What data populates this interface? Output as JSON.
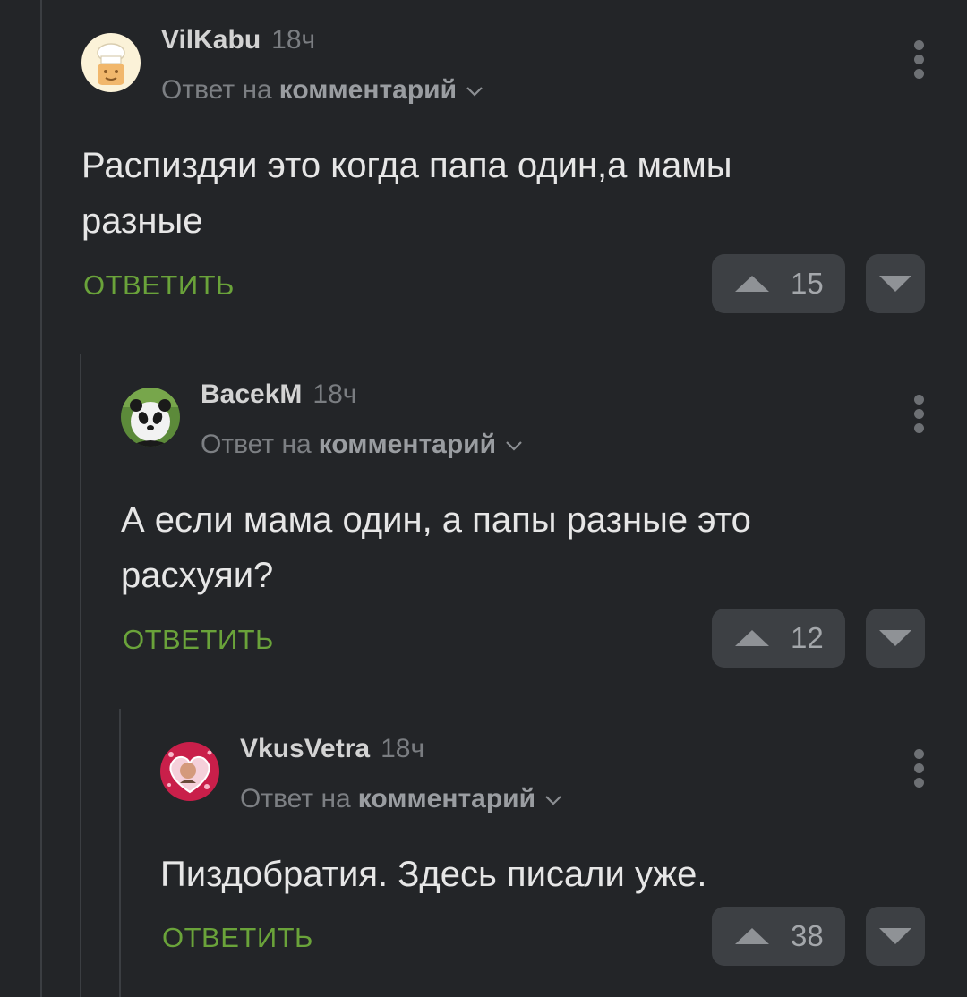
{
  "comments": [
    {
      "username": "VilKabu",
      "time": "18ч",
      "reply_prefix": "Ответ на",
      "reply_target": "комментарий",
      "text": "Распиздяи это когда папа один,а мамы разные",
      "reply_label": "ОТВЕТИТЬ",
      "rating": "15",
      "avatar_icon": "chef-avatar-icon"
    },
    {
      "username": "BacekM",
      "time": "18ч",
      "reply_prefix": "Ответ на",
      "reply_target": "комментарий",
      "text": "А если мама один, а папы разные это расхуяи?",
      "reply_label": "ОТВЕТИТЬ",
      "rating": "12",
      "avatar_icon": "panda-avatar-icon"
    },
    {
      "username": "VkusVetra",
      "time": "18ч",
      "reply_prefix": "Ответ на",
      "reply_target": "комментарий",
      "text": "Пиздобратия. Здесь писали уже.",
      "reply_label": "ОТВЕТИТЬ",
      "rating": "38",
      "avatar_icon": "heart-photo-avatar-icon"
    }
  ],
  "colors": {
    "background": "#232528",
    "reply_green": "#6aa33a",
    "vote_button": "#3d4044"
  }
}
